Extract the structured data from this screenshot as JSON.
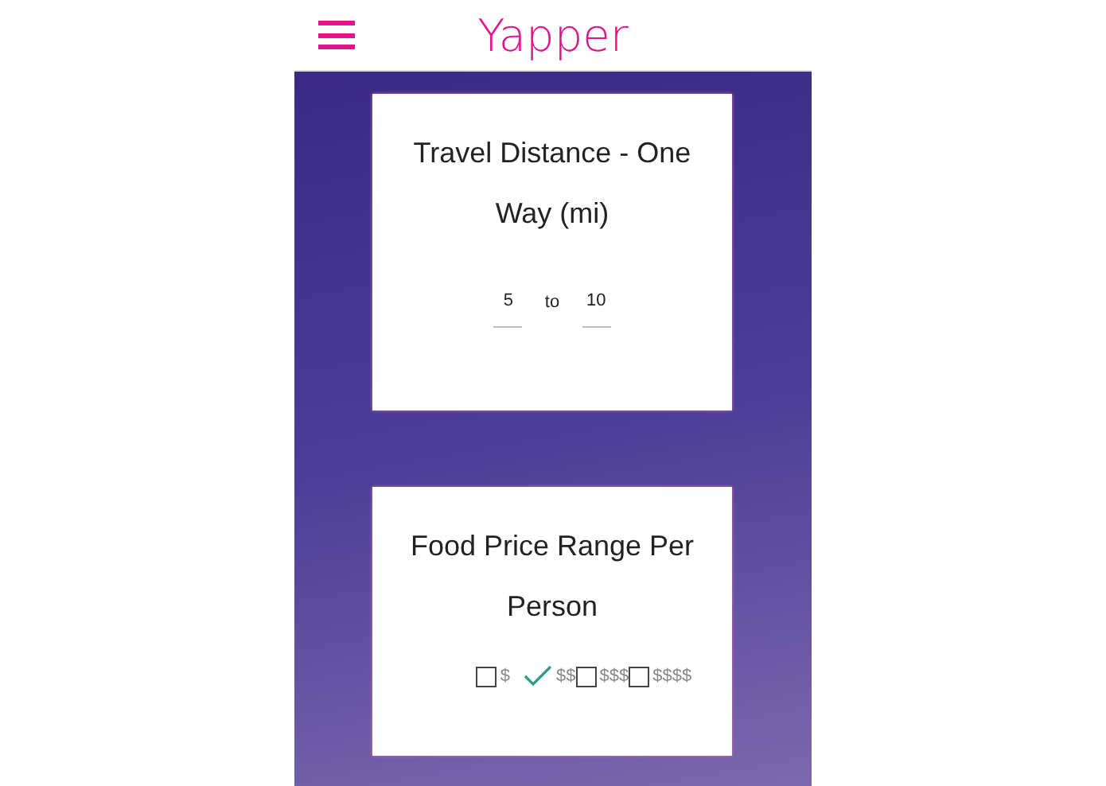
{
  "header": {
    "title": "Yapper"
  },
  "distance_card": {
    "title": "Travel Distance - One Way (mi)",
    "from": "5",
    "separator": "to",
    "to": "10"
  },
  "price_card": {
    "title": "Food Price Range Per Person",
    "options": [
      {
        "label": "$",
        "checked": false
      },
      {
        "label": "$$",
        "checked": true
      },
      {
        "label": "$$$",
        "checked": false
      },
      {
        "label": "$$$$",
        "checked": false
      }
    ]
  }
}
